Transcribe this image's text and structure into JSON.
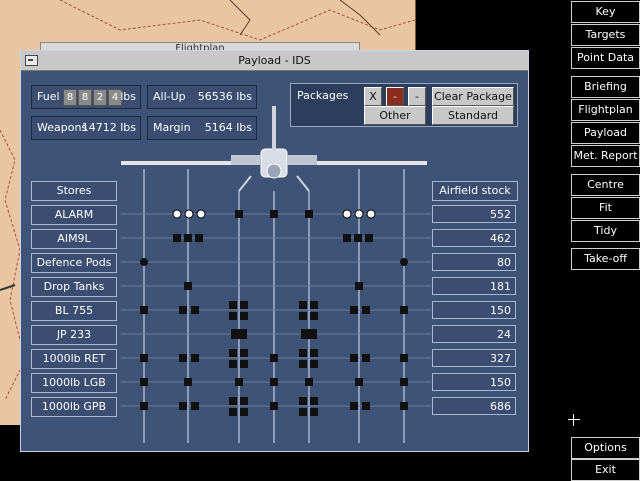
{
  "bg_window_title": "Flightplan",
  "window_title": "Payload - IDS",
  "fuel": {
    "label": "Fuel",
    "digits": [
      "8",
      "8",
      "2",
      "4"
    ],
    "unit": "lbs"
  },
  "all_up": {
    "label": "All-Up",
    "value": "56536 lbs"
  },
  "weapons": {
    "label": "Weapons",
    "value": "14712 lbs"
  },
  "margin": {
    "label": "Margin",
    "value": "5164 lbs"
  },
  "packages": {
    "label": "Packages",
    "x": "X",
    "minus_red": "-",
    "minus": "-",
    "clear": "Clear Package",
    "other": "Other",
    "standard": "Standard"
  },
  "stores_header": "Stores",
  "stock_header": "Airfield stock",
  "stores": [
    {
      "name": "ALARM",
      "stock": "552"
    },
    {
      "name": "AIM9L",
      "stock": "462"
    },
    {
      "name": "Defence Pods",
      "stock": "80"
    },
    {
      "name": "Drop Tanks",
      "stock": "181"
    },
    {
      "name": "BL 755",
      "stock": "150"
    },
    {
      "name": "JP 233",
      "stock": "24"
    },
    {
      "name": "1000lb RET",
      "stock": "327"
    },
    {
      "name": "1000lb LGB",
      "stock": "150"
    },
    {
      "name": "1000lb GPB",
      "stock": "686"
    }
  ],
  "menu": {
    "key": "Key",
    "targets": "Targets",
    "point_data": "Point Data",
    "briefing": "Briefing",
    "flightplan": "Flightplan",
    "payload": "Payload",
    "met_report": "Met. Report",
    "centre": "Centre",
    "fit": "Fit",
    "tidy": "Tidy",
    "take_off": "Take-off",
    "options": "Options",
    "exit": "Exit"
  },
  "colors": {
    "window_bg": "#3f5377",
    "map_bg": "#e9c6a2",
    "red_button": "#8a2d1e"
  }
}
